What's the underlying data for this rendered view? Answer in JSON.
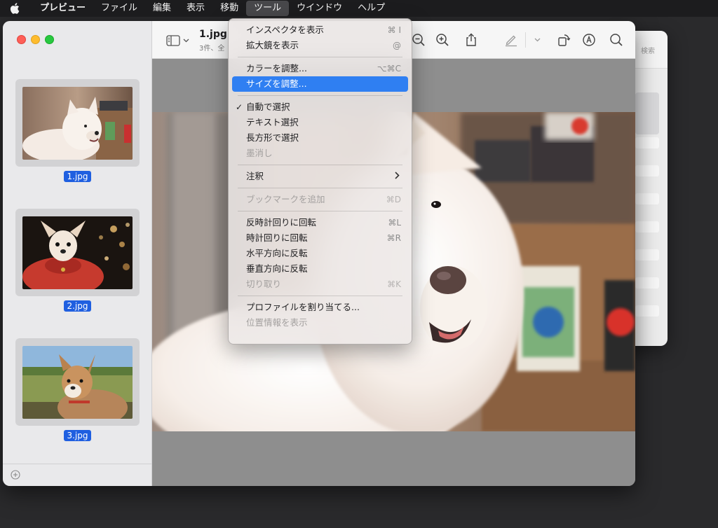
{
  "menubar": {
    "app": "プレビュー",
    "items": [
      "ファイル",
      "編集",
      "表示",
      "移動",
      "ツール",
      "ウインドウ",
      "ヘルプ"
    ],
    "active_index": 4
  },
  "window": {
    "doc_title": "1.jpg",
    "doc_subtitle": "3件、全"
  },
  "sidebar": {
    "thumbnails": [
      {
        "label": "1.jpg"
      },
      {
        "label": "2.jpg"
      },
      {
        "label": "3.jpg"
      }
    ]
  },
  "background_window": {
    "search_label": "検索"
  },
  "tools_menu": {
    "items": {
      "inspector": {
        "label": "インスペクタを表示",
        "shortcut": "⌘ I"
      },
      "magnifier": {
        "label": "拡大鏡を表示",
        "shortcut": "@"
      },
      "adjust_color": {
        "label": "カラーを調整...",
        "shortcut": "⌥⌘C"
      },
      "adjust_size": {
        "label": "サイズを調整..."
      },
      "auto_select": {
        "label": "自動で選択",
        "checked": true
      },
      "text_select": {
        "label": "テキスト選択"
      },
      "rect_select": {
        "label": "長方形で選択"
      },
      "redact": {
        "label": "墨消し"
      },
      "annotate": {
        "label": "注釈"
      },
      "add_bookmark": {
        "label": "ブックマークを追加",
        "shortcut": "⌘D"
      },
      "rotate_left": {
        "label": "反時計回りに回転",
        "shortcut": "⌘L"
      },
      "rotate_right": {
        "label": "時計回りに回転",
        "shortcut": "⌘R"
      },
      "flip_horizontal": {
        "label": "水平方向に反転"
      },
      "flip_vertical": {
        "label": "垂直方向に反転"
      },
      "crop": {
        "label": "切り取り",
        "shortcut": "⌘K"
      },
      "assign_profile": {
        "label": "プロファイルを割り当てる..."
      },
      "show_location": {
        "label": "位置情報を表示"
      }
    }
  },
  "colors": {
    "selection_blue": "#2f7ff2",
    "thumb_label_blue": "#1f5fe0"
  }
}
